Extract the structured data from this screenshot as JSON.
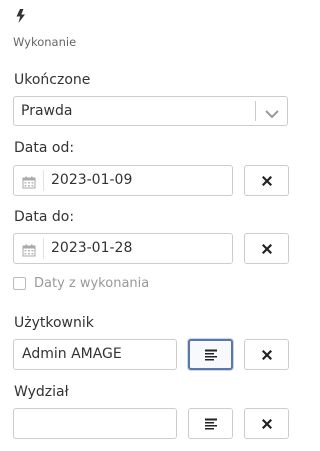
{
  "section": {
    "icon": "bolt-icon",
    "title": "Wykonanie"
  },
  "completed": {
    "label": "Ukończone",
    "value": "Prawda",
    "icon": "chevron-down-icon"
  },
  "date_from": {
    "label": "Data od:",
    "value": "2023-01-09",
    "icon": "calendar-icon",
    "clear_icon": "close-icon"
  },
  "date_to": {
    "label": "Data do:",
    "value": "2023-01-28",
    "icon": "calendar-icon",
    "clear_icon": "close-icon"
  },
  "execution_dates": {
    "label": "Daty z wykonania",
    "checked": false
  },
  "user": {
    "label": "Użytkownik",
    "value": "Admin AMAGE",
    "picker_icon": "list-icon",
    "clear_icon": "close-icon"
  },
  "department": {
    "label": "Wydział",
    "value": "",
    "picker_icon": "list-icon",
    "clear_icon": "close-icon"
  },
  "colors": {
    "text": "#333333",
    "muted": "#999999",
    "border": "#cccccc",
    "active_border": "#5a77a8"
  }
}
